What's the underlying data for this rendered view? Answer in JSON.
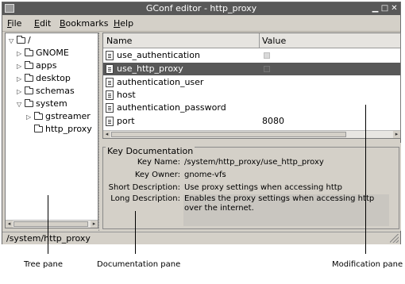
{
  "window": {
    "title": "GConf editor - http_proxy"
  },
  "menubar": {
    "items": [
      {
        "label": "File",
        "mnemonic": "F",
        "rest": "ile"
      },
      {
        "label": "Edit",
        "mnemonic": "E",
        "rest": "dit"
      },
      {
        "label": "Bookmarks",
        "mnemonic": "B",
        "rest": "ookmarks"
      },
      {
        "label": "Help",
        "mnemonic": "H",
        "rest": "elp"
      }
    ]
  },
  "tree": {
    "items": [
      {
        "label": "/",
        "expanded": true,
        "depth": 0
      },
      {
        "label": "GNOME",
        "expanded": false,
        "depth": 1
      },
      {
        "label": "apps",
        "expanded": false,
        "depth": 1
      },
      {
        "label": "desktop",
        "expanded": false,
        "depth": 1
      },
      {
        "label": "schemas",
        "expanded": false,
        "depth": 1
      },
      {
        "label": "system",
        "expanded": true,
        "depth": 1
      },
      {
        "label": "gstreamer",
        "expanded": false,
        "depth": 2
      },
      {
        "label": "http_proxy",
        "expanded": null,
        "depth": 2
      }
    ]
  },
  "list": {
    "columns": {
      "name": "Name",
      "value": "Value"
    },
    "rows": [
      {
        "name": "use_authentication",
        "value": "",
        "type": "bool",
        "selected": false
      },
      {
        "name": "use_http_proxy",
        "value": "",
        "type": "bool",
        "selected": true
      },
      {
        "name": "authentication_user",
        "value": "",
        "type": "string",
        "selected": false
      },
      {
        "name": "host",
        "value": "",
        "type": "string",
        "selected": false
      },
      {
        "name": "authentication_password",
        "value": "",
        "type": "string",
        "selected": false
      },
      {
        "name": "port",
        "value": "8080",
        "type": "int",
        "selected": false
      }
    ]
  },
  "documentation": {
    "title": "Key Documentation",
    "key_name_label": "Key Name:",
    "key_name": "/system/http_proxy/use_http_proxy",
    "key_owner_label": "Key Owner:",
    "key_owner": "gnome-vfs",
    "short_desc_label": "Short Description:",
    "short_desc": "Use proxy settings when accessing http",
    "long_desc_label": "Long Description:",
    "long_desc": "Enables the proxy settings when accessing http over the internet."
  },
  "statusbar": {
    "path": "/system/http_proxy"
  },
  "callouts": {
    "tree": "Tree pane",
    "documentation": "Documentation pane",
    "modification": "Modification pane"
  },
  "colors": {
    "titlebar": "#585858",
    "selection": "#585858",
    "chrome": "#d4d0c8"
  }
}
